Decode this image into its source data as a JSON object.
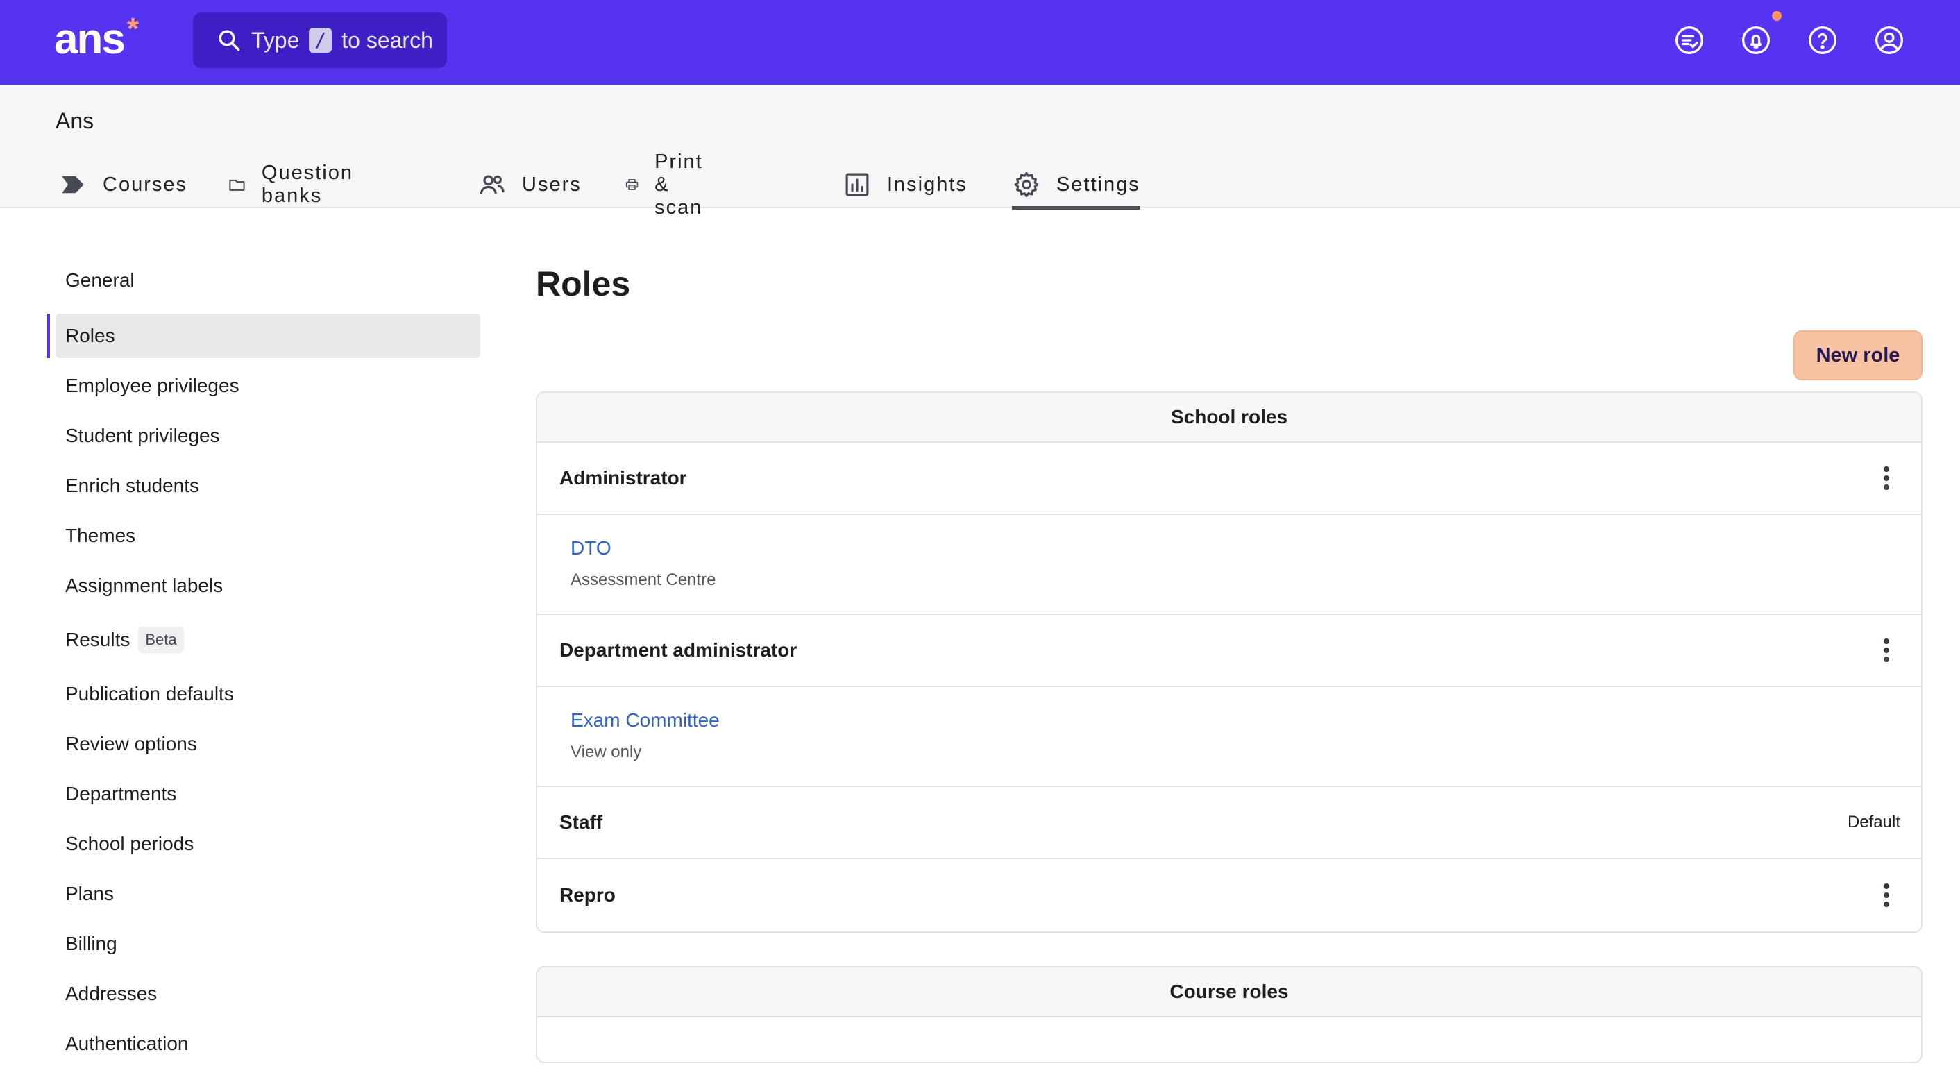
{
  "app": {
    "logo_text": "ans",
    "logo_mark": "*",
    "brand_color": "#5533f1",
    "accent_color": "#f7c3a3"
  },
  "search": {
    "prefix": "Type",
    "shortcut": "/",
    "suffix": "to search",
    "icon": "search-icon"
  },
  "top_icons": [
    "task-list-icon",
    "bell-icon",
    "help-icon",
    "account-icon"
  ],
  "org": {
    "name": "Ans"
  },
  "tabs": [
    {
      "label": "Courses",
      "icon": "courses-icon"
    },
    {
      "label": "Question banks",
      "icon": "folder-icon"
    },
    {
      "label": "Users",
      "icon": "users-icon"
    },
    {
      "label": "Print & scan",
      "icon": "printer-icon"
    },
    {
      "label": "Insights",
      "icon": "chart-icon"
    },
    {
      "label": "Settings",
      "icon": "gear-icon",
      "active": true
    }
  ],
  "sidebar": {
    "items": [
      {
        "label": "General"
      },
      {
        "label": "Roles",
        "active": true
      },
      {
        "label": "Employee privileges"
      },
      {
        "label": "Student privileges"
      },
      {
        "label": "Enrich students"
      },
      {
        "label": "Themes"
      },
      {
        "label": "Assignment labels"
      },
      {
        "label": "Results",
        "badge": "Beta"
      },
      {
        "label": "Publication defaults"
      },
      {
        "label": "Review options"
      },
      {
        "label": "Departments"
      },
      {
        "label": "School periods"
      },
      {
        "label": "Plans"
      },
      {
        "label": "Billing"
      },
      {
        "label": "Addresses"
      },
      {
        "label": "Authentication"
      }
    ]
  },
  "main": {
    "title": "Roles",
    "new_role_label": "New role",
    "school_roles": {
      "header": "School roles",
      "roles": [
        {
          "name": "Administrator",
          "menu": true,
          "sub": {
            "link": "DTO",
            "desc": "Assessment Centre"
          }
        },
        {
          "name": "Department administrator",
          "menu": true,
          "sub": {
            "link": "Exam Committee",
            "desc": "View only"
          }
        },
        {
          "name": "Staff",
          "default_label": "Default"
        },
        {
          "name": "Repro",
          "menu": true
        }
      ]
    },
    "course_roles": {
      "header": "Course roles"
    }
  }
}
